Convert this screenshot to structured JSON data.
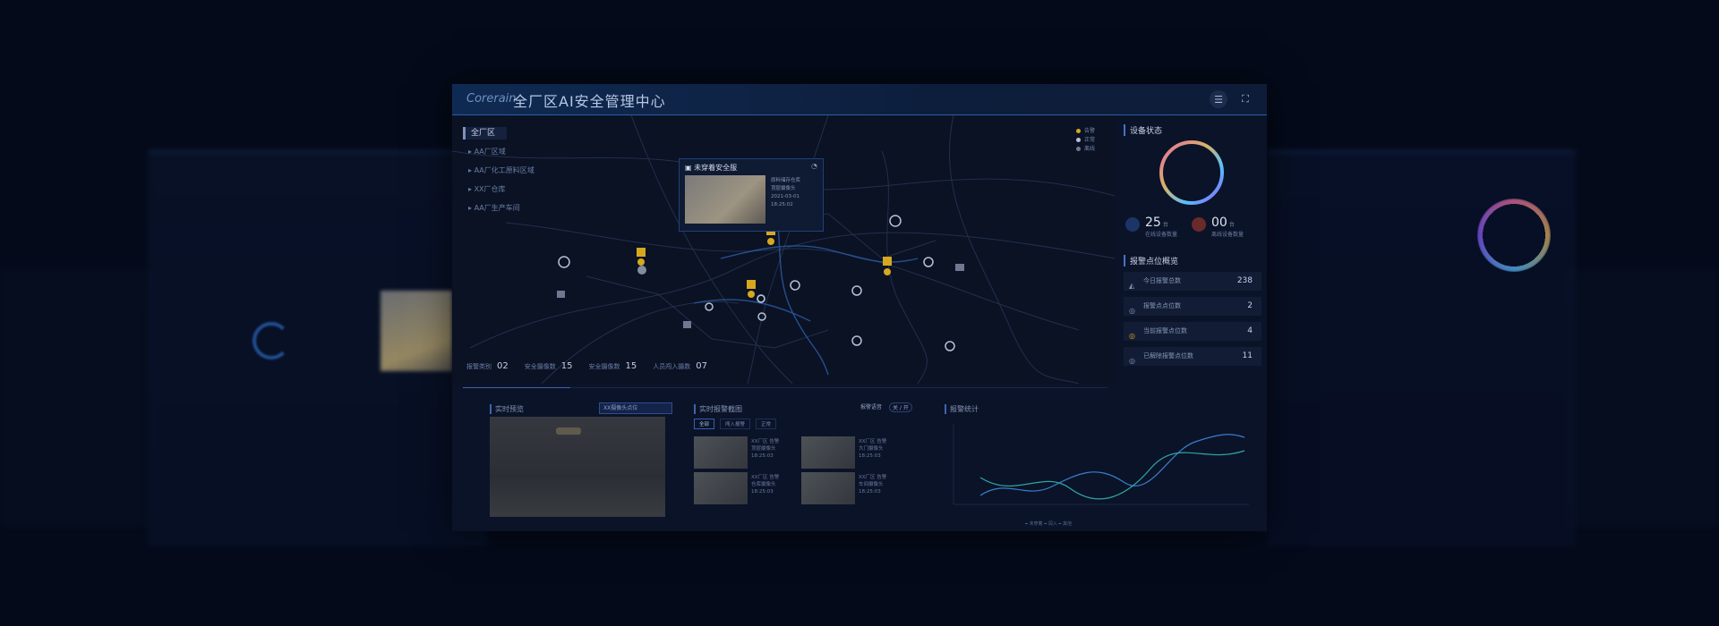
{
  "header": {
    "logo": "Corerain",
    "title": "全厂区AI安全管理中心"
  },
  "regions": {
    "title": "全厂区",
    "items": [
      "AA厂区域",
      "AA厂化工原料区域",
      "XX厂仓库",
      "AA厂生产车间"
    ]
  },
  "map_legend": [
    "告警",
    "正常",
    "离线"
  ],
  "popup": {
    "title": "未穿着安全服",
    "info": [
      "原料储存仓库",
      "顶层摄像头",
      "2021-03-01 18:25:02"
    ]
  },
  "stats_bar": [
    {
      "label": "报警类别",
      "value": "02"
    },
    {
      "label": "安全摄像数",
      "value": "15"
    },
    {
      "label": "安全摄像数",
      "value": "15"
    },
    {
      "label": "人员闯入摄数",
      "value": "07"
    }
  ],
  "device_status": {
    "title": "设备状态",
    "online": {
      "value": "25",
      "unit": "台",
      "label": "在线设备数量"
    },
    "offline": {
      "value": "00",
      "unit": "台",
      "label": "离线设备数量"
    }
  },
  "alarm_overview": {
    "title": "报警点位概览",
    "items": [
      {
        "label": "今日报警总数",
        "value": "238"
      },
      {
        "label": "报警点点位数",
        "value": "2"
      },
      {
        "label": "当前报警点位数",
        "value": "4"
      },
      {
        "label": "已解除报警点位数",
        "value": "11"
      }
    ]
  },
  "bottom": {
    "preview_title": "实时预览",
    "camera_select": "XX摄像头点位",
    "alarm_title": "实时报警截图",
    "sound_label": "报警语音",
    "sound_toggle": "关 / 开",
    "filters": [
      "全部",
      "闯入报警",
      "正常"
    ],
    "alarm_cards": [
      {
        "line1": "XX厂区 告警",
        "line2": "顶层摄像头",
        "line3": "18:25:03"
      },
      {
        "line1": "XX厂区 告警",
        "line2": "大门摄像头",
        "line3": "18:25:03"
      },
      {
        "line1": "XX厂区 告警",
        "line2": "仓库摄像头",
        "line3": "18:25:03"
      },
      {
        "line1": "XX厂区 告警",
        "line2": "车间摄像头",
        "line3": "18:25:03"
      }
    ],
    "stats_title": "报警统计",
    "chart_legend": "━ 未穿着   ━ 闯入   ━ 其他"
  },
  "colors": {
    "accent": "#3e64a8",
    "marker_alarm": "#d6a820",
    "marker_normal": "#b7c1d4"
  }
}
